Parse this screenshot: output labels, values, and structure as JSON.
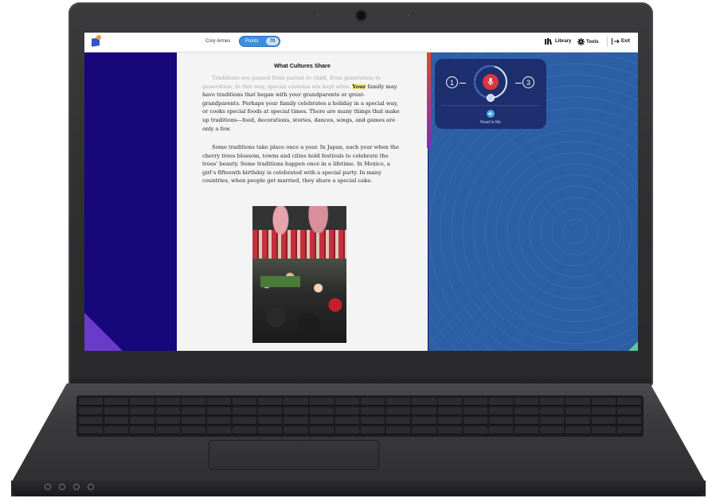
{
  "header": {
    "user_name": "Cory Armes",
    "points_label": "Points",
    "points_value": "70",
    "nav": [
      {
        "label": "Library",
        "icon": "library-icon"
      },
      {
        "label": "Tools",
        "icon": "gear-icon"
      },
      {
        "label": "Exit",
        "icon": "exit-icon"
      }
    ]
  },
  "reader": {
    "title": "What Cultures Share",
    "paragraph1": {
      "faded": "Traditions are passed from parent to child, from generation to generation. In this way, special customs are kept alive.",
      "highlight": "Your",
      "rest": " family may have traditions that began with your grandparents or great-grandparents. Perhaps your family celebrates a holiday in a special way, or cooks special foods at special times. There are many things that make up traditions—food, decorations, stories, dances, songs, and games are only a few."
    },
    "paragraph2": "Some traditions take place once a year. In Japan, each year when the cherry trees blossom, towns and cities hold festivals to celebrate the trees’ beauty. Some traditions happen once in a lifetime. In Mexico, a girl’s fifteenth birthday is celebrated with a special party. In many countries, when people get married, they share a special cake."
  },
  "recorder": {
    "step_left": "1",
    "step_right": "3",
    "read_to_me_label": "Read to Me"
  },
  "colors": {
    "left_background": "#17077a",
    "right_background": "#2d5fa6",
    "points_pill": "#3d8ee0",
    "mic_red": "#d9363e",
    "highlight": "#f7f38f"
  }
}
